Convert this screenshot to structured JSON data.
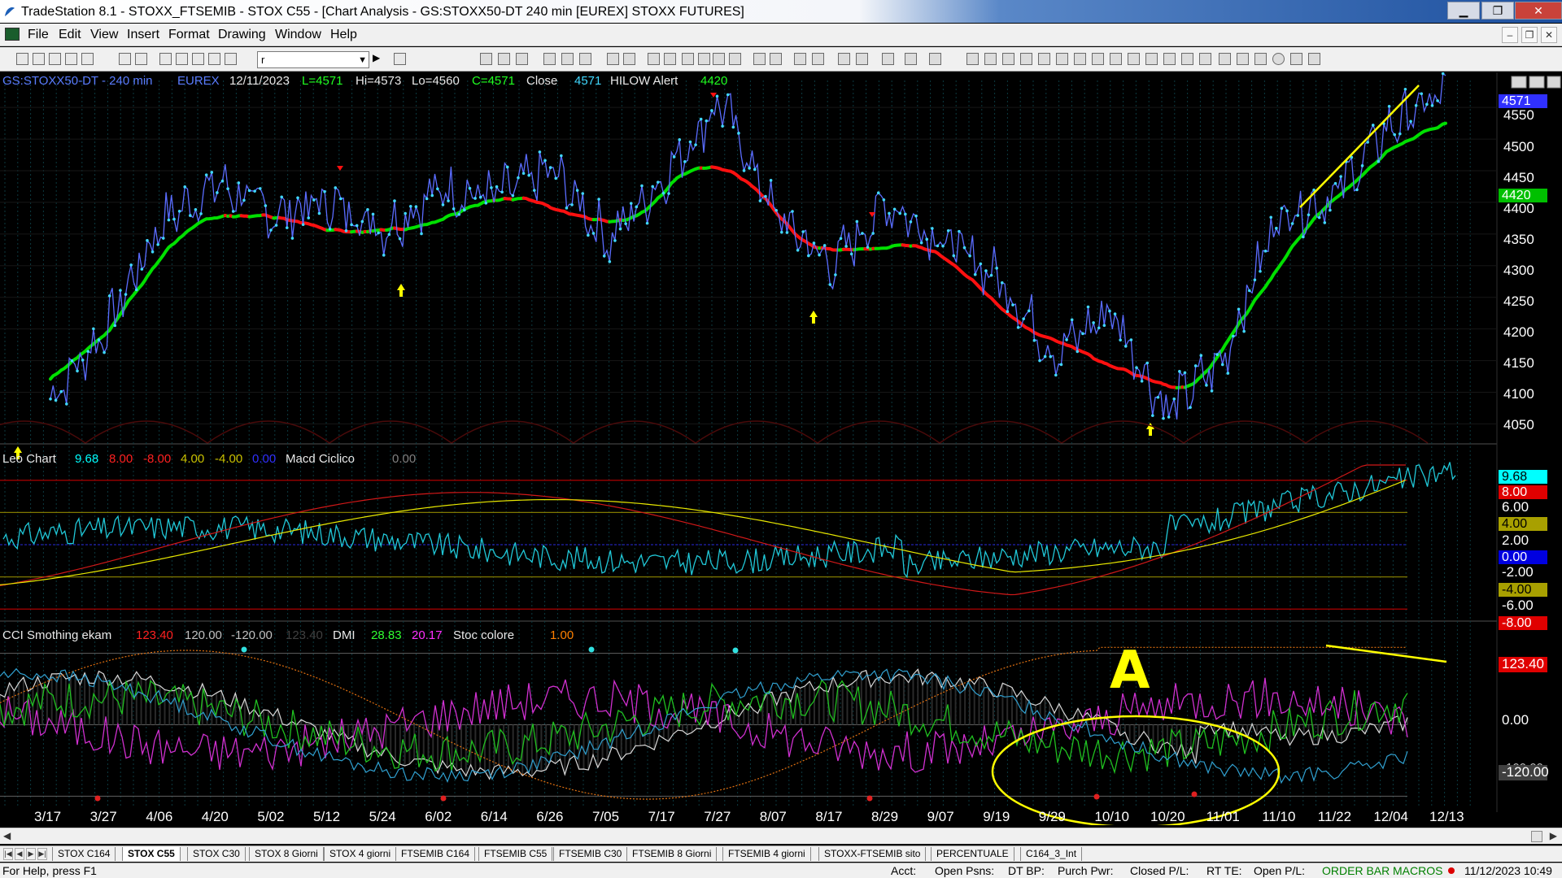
{
  "window": {
    "title": "TradeStation 8.1 - STOXX_FTSEMIB - STOX C55 - [Chart Analysis - GS:STOXX50-DT  240 min  [EUREX] STOXX FUTURES]",
    "buttons": {
      "minimize": "▁",
      "maximize": "❐",
      "close": "✕"
    }
  },
  "menu": {
    "items": [
      "File",
      "Edit",
      "View",
      "Insert",
      "Format",
      "Drawing",
      "Window",
      "Help"
    ],
    "mdi_buttons": [
      "–",
      "❐",
      "✕"
    ]
  },
  "toolbar": {
    "symbol_value": "r"
  },
  "chart": {
    "header": {
      "symbol": "GS:STOXX50-DT - 240 min",
      "exchange": "EUREX",
      "date": "12/11/2023",
      "last": "L=4571",
      "hi": "Hi=4573",
      "lo": "Lo=4560",
      "close_val": "C=4571",
      "close_label": "Close",
      "close_num": "4571",
      "indicator_name": "HILOW Alert",
      "indicator_val": "4420"
    },
    "price_axis": {
      "ticks": [
        "4550",
        "4500",
        "4450",
        "4400",
        "4350",
        "4300",
        "4250",
        "4200",
        "4150",
        "4100",
        "4050"
      ],
      "last_box": "4571",
      "hilow_box": "4420"
    },
    "price_range": [
      4030,
      4590
    ],
    "macd_panel": {
      "title": "Leo Chart",
      "vals": [
        "9.68",
        "8.00",
        "-8.00",
        "4.00",
        "-4.00",
        "0.00"
      ],
      "val_colors": [
        "#00ffff",
        "#ff2020",
        "#ff2020",
        "#c8c000",
        "#c8c000",
        "#3030ff"
      ],
      "macd_name": "Macd Ciclico",
      "macd_val": "0.00",
      "axis_ticks": [
        "6.00",
        "2.00",
        "-2.00",
        "-6.00"
      ],
      "boxes": [
        {
          "text": "9.68",
          "bg": "#00ffff",
          "fg": "#000"
        },
        {
          "text": "8.00",
          "bg": "#e00000",
          "fg": "#fff"
        },
        {
          "text": "4.00",
          "bg": "#a8a000",
          "fg": "#000"
        },
        {
          "text": "0.00",
          "bg": "#0000e0",
          "fg": "#fff"
        },
        {
          "text": "-4.00",
          "bg": "#a8a000",
          "fg": "#000"
        },
        {
          "text": "-8.00",
          "bg": "#e00000",
          "fg": "#fff"
        }
      ]
    },
    "cci_panel": {
      "title": "CCI Smothing ekam",
      "vals": [
        "123.40",
        "120.00",
        "-120.00",
        "123.40"
      ],
      "val_colors": [
        "#ff2020",
        "#c0c0c0",
        "#c0c0c0",
        "#404040"
      ],
      "dmi_name": "DMI",
      "dmi_vals": [
        "28.83",
        "20.17"
      ],
      "dmi_colors": [
        "#30ff30",
        "#ff30ff"
      ],
      "stoc_name": "Stoc colore",
      "stoc_val": "1.00",
      "axis_ticks": [
        "0.00"
      ],
      "top_box": "123.40",
      "bottom_box": "-120.00",
      "bottom_box_partial": "-100.00"
    },
    "dates": [
      "3/17",
      "3/27",
      "4/06",
      "4/20",
      "5/02",
      "5/12",
      "5/24",
      "6/02",
      "6/14",
      "6/26",
      "7/05",
      "7/17",
      "7/27",
      "8/07",
      "8/17",
      "8/29",
      "9/07",
      "9/19",
      "9/29",
      "10/10",
      "10/20",
      "11/01",
      "11/10",
      "11/22",
      "12/04",
      "12/13"
    ],
    "annotation": "A",
    "colors": {
      "up": "#00e000",
      "down": "#ff1010",
      "price": "#40d8ff",
      "trendline": "#ffff00",
      "arrow": "#ffff00"
    }
  },
  "chart_data": {
    "type": "line",
    "title": "GS:STOXX50-DT - 240 min",
    "x": [
      "3/17",
      "3/27",
      "4/06",
      "4/20",
      "5/02",
      "5/12",
      "5/24",
      "6/02",
      "6/14",
      "6/26",
      "7/05",
      "7/17",
      "7/27",
      "8/07",
      "8/17",
      "8/29",
      "9/07",
      "9/19",
      "9/29",
      "10/10",
      "10/20",
      "11/01",
      "11/10",
      "11/22",
      "12/04",
      "12/13"
    ],
    "series": [
      {
        "name": "Close",
        "values": [
          4090,
          4200,
          4370,
          4430,
          4380,
          4400,
          4360,
          4420,
          4410,
          4450,
          4340,
          4440,
          4560,
          4380,
          4300,
          4400,
          4340,
          4280,
          4160,
          4230,
          4070,
          4150,
          4380,
          4410,
          4520,
          4571
        ]
      }
    ],
    "ylim": [
      4030,
      4590
    ],
    "xlabel": "",
    "ylabel": ""
  },
  "tabs": [
    "STOX C164",
    "STOX C55",
    "STOX  C30",
    "STOX  8 Giorni",
    "STOX 4 giorni",
    "FTSEMIB C164",
    "FTSEMIB C55",
    "FTSEMIB C30",
    "FTSEMIB  8 Giorni",
    "FTSEMIB  4 giorni",
    "STOXX-FTSEMIB sito",
    "PERCENTUALE",
    "C164_3_Int"
  ],
  "active_tab": "STOX C55",
  "status": {
    "help": "For Help, press F1",
    "acct": "Acct:",
    "open_psns": "Open Psns:",
    "dt_bp": "DT BP:",
    "purch_pwr": "Purch Pwr:",
    "closed_pl": "Closed P/L:",
    "rt_te": "RT TE:",
    "open_pl": "Open P/L:",
    "order_bar": "ORDER BAR",
    "macros": "MACROS",
    "datetime": "11/12/2023 10:49"
  }
}
